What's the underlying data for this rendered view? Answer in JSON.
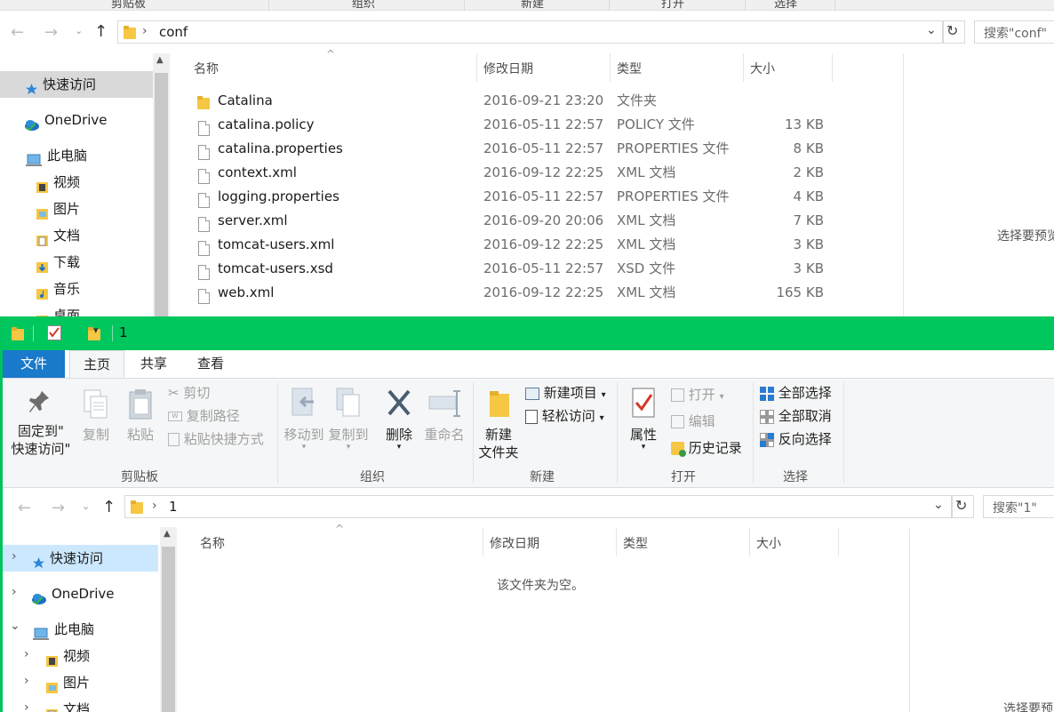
{
  "back_window": {
    "ribbon_groups": [
      "剪贴板",
      "组织",
      "新建",
      "打开",
      "选择"
    ],
    "address": {
      "path": [
        "conf"
      ]
    },
    "search_placeholder": "搜索\"conf\"",
    "columns": {
      "name": "名称",
      "date": "修改日期",
      "type": "类型",
      "size": "大小"
    },
    "nav": [
      {
        "label": "快速访问",
        "icon": "star-icon"
      },
      {
        "label": "OneDrive",
        "icon": "cloud-icon"
      },
      {
        "label": "此电脑",
        "icon": "computer-icon"
      },
      {
        "label": "视频",
        "icon": "video-folder-icon"
      },
      {
        "label": "图片",
        "icon": "pictures-folder-icon"
      },
      {
        "label": "文档",
        "icon": "documents-folder-icon"
      },
      {
        "label": "下载",
        "icon": "downloads-folder-icon"
      },
      {
        "label": "音乐",
        "icon": "music-folder-icon"
      },
      {
        "label": "桌面",
        "icon": "desktop-folder-icon"
      }
    ],
    "files": [
      {
        "name": "Catalina",
        "date": "2016-09-21 23:20",
        "type": "文件夹",
        "size": "",
        "icon": "folder-icon"
      },
      {
        "name": "catalina.policy",
        "date": "2016-05-11 22:57",
        "type": "POLICY 文件",
        "size": "13 KB",
        "icon": "file-icon"
      },
      {
        "name": "catalina.properties",
        "date": "2016-05-11 22:57",
        "type": "PROPERTIES 文件",
        "size": "8 KB",
        "icon": "file-icon"
      },
      {
        "name": "context.xml",
        "date": "2016-09-12 22:25",
        "type": "XML 文档",
        "size": "2 KB",
        "icon": "file-icon"
      },
      {
        "name": "logging.properties",
        "date": "2016-05-11 22:57",
        "type": "PROPERTIES 文件",
        "size": "4 KB",
        "icon": "file-icon"
      },
      {
        "name": "server.xml",
        "date": "2016-09-20 20:06",
        "type": "XML 文档",
        "size": "7 KB",
        "icon": "file-icon"
      },
      {
        "name": "tomcat-users.xml",
        "date": "2016-09-12 22:25",
        "type": "XML 文档",
        "size": "3 KB",
        "icon": "file-icon"
      },
      {
        "name": "tomcat-users.xsd",
        "date": "2016-05-11 22:57",
        "type": "XSD 文件",
        "size": "3 KB",
        "icon": "file-icon"
      },
      {
        "name": "web.xml",
        "date": "2016-09-12 22:25",
        "type": "XML 文档",
        "size": "165 KB",
        "icon": "file-icon"
      }
    ],
    "preview_text": "选择要预览"
  },
  "front_window": {
    "title": "1",
    "accent_color": "#00c65e",
    "tabs": [
      "文件",
      "主页",
      "共享",
      "查看"
    ],
    "ribbon": {
      "clipboard": {
        "pin_line1": "固定到\"",
        "pin_line2": "快速访问\"",
        "copy": "复制",
        "paste": "粘贴",
        "cut": "剪切",
        "copy_path": "复制路径",
        "paste_shortcut": "粘贴快捷方式",
        "group": "剪贴板"
      },
      "organize": {
        "move_to": "移动到",
        "copy_to": "复制到",
        "delete": "删除",
        "rename": "重命名",
        "group": "组织"
      },
      "new": {
        "new_folder_line1": "新建",
        "new_folder_line2": "文件夹",
        "new_item": "新建项目",
        "easy_access": "轻松访问",
        "group": "新建"
      },
      "open": {
        "properties": "属性",
        "open": "打开",
        "edit": "编辑",
        "history": "历史记录",
        "group": "打开"
      },
      "select": {
        "select_all": "全部选择",
        "select_none": "全部取消",
        "invert": "反向选择",
        "group": "选择"
      }
    },
    "address": {
      "path": [
        "1"
      ]
    },
    "search_placeholder": "搜索\"1\"",
    "columns": {
      "name": "名称",
      "date": "修改日期",
      "type": "类型",
      "size": "大小"
    },
    "empty_text": "该文件夹为空。",
    "nav": [
      {
        "label": "快速访问",
        "icon": "star-icon"
      },
      {
        "label": "OneDrive",
        "icon": "cloud-icon"
      },
      {
        "label": "此电脑",
        "icon": "computer-icon"
      },
      {
        "label": "视频",
        "icon": "video-folder-icon"
      },
      {
        "label": "图片",
        "icon": "pictures-folder-icon"
      },
      {
        "label": "文档",
        "icon": "documents-folder-icon"
      }
    ],
    "preview_text": "选择要预览"
  }
}
